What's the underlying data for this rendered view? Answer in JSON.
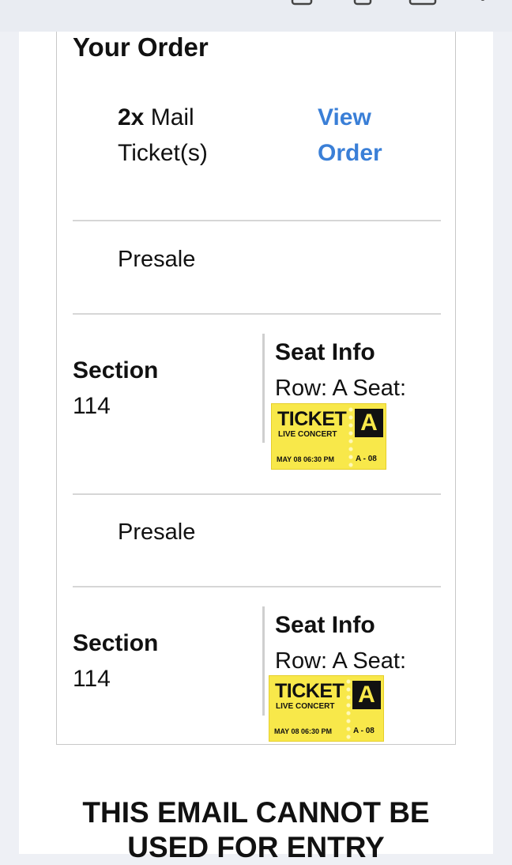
{
  "order": {
    "title": "Your Order",
    "quantity_bold": "2x",
    "quantity_rest": " Mail Ticket(s)",
    "view_order_label": "View Order"
  },
  "items": [
    {
      "price_type": "Presale",
      "section_label": "Section",
      "section_value": "114",
      "seat_info_title": "Seat Info",
      "seat_row_text": "Row: A Seat:",
      "ticket_image": {
        "word": "TICKET",
        "subtitle": "LIVE CONCERT",
        "letter": "A",
        "date_text": "MAY 08 06:30 PM",
        "seat_code": "A - 08"
      }
    },
    {
      "price_type": "Presale",
      "section_label": "Section",
      "section_value": "114",
      "seat_info_title": "Seat Info",
      "seat_row_text": "Row: A Seat:",
      "ticket_image": {
        "word": "TICKET",
        "subtitle": "LIVE CONCERT",
        "letter": "A",
        "date_text": "MAY 08 06:30 PM",
        "seat_code": "A - 08"
      }
    }
  ],
  "footer": {
    "notice_line1": "THIS EMAIL CANNOT BE",
    "notice_line2": "USED FOR ENTRY"
  },
  "colors": {
    "link": "#3a7fd7",
    "ticket_yellow": "#f8e84a",
    "page_bg": "#eef0f5"
  },
  "icons": [
    "back-arrow-icon",
    "archive-icon",
    "delete-icon",
    "mail-icon",
    "more-icon"
  ]
}
